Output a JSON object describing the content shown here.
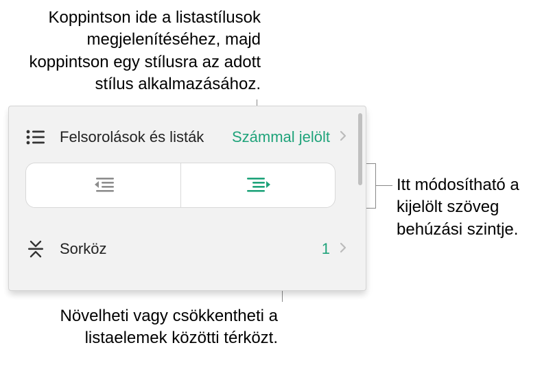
{
  "annotations": {
    "top": "Koppintson ide a listastílusok megjelenítéséhez, majd koppintson egy stílusra az adott stílus alkalmazásához.",
    "right": "Itt módosítható a kijelölt szöveg behúzási szintje.",
    "bottom": "Növelheti vagy csökkentheti a listaelemek közötti térközt."
  },
  "panel": {
    "lists": {
      "label": "Felsorolások és listák",
      "value": "Számmal jelölt"
    },
    "spacing": {
      "label": "Sorköz",
      "value": "1"
    }
  },
  "colors": {
    "accent": "#1fa37a"
  }
}
